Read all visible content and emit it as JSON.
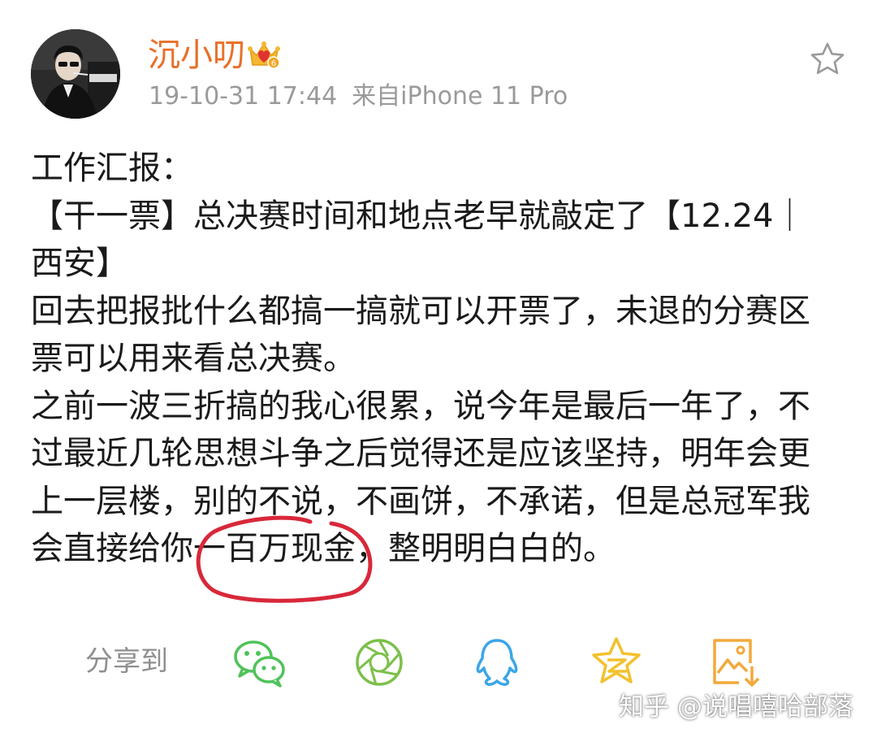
{
  "post": {
    "username": "沉小叨",
    "timestamp": "19-10-31 17:44",
    "source": "来自iPhone 11 Pro",
    "lines": [
      "工作汇报：",
      "【干一票】总决赛时间和地点老早就敲定了【12.24｜",
      "西安】",
      "回去把报批什么都搞一搞就可以开票了，未退的分赛区",
      "票可以用来看总决赛。",
      "之前一波三折搞的我心很累，说今年是最后一年了，不",
      "过最近几轮思想斗争之后觉得还是应该坚持，明年会更",
      "上一层楼，别的不说，不画饼，不承诺，但是总冠军我",
      "会直接给你一百万现金，整明明白白的。"
    ]
  },
  "share": {
    "label": "分享到",
    "targets": [
      {
        "icon": "wechat-icon",
        "color": "#4fc25a"
      },
      {
        "icon": "moments-icon",
        "color": "#7cc04a"
      },
      {
        "icon": "qq-icon",
        "color": "#3aa6e8"
      },
      {
        "icon": "qzone-icon",
        "color": "#f2c12e"
      },
      {
        "icon": "save-image-icon",
        "color": "#f2a93b"
      }
    ]
  },
  "colors": {
    "username": "#e8702a",
    "meta": "#9a9a9a",
    "annotation": "#d8283a"
  },
  "watermark": "知乎 @说唱嘻哈部落"
}
